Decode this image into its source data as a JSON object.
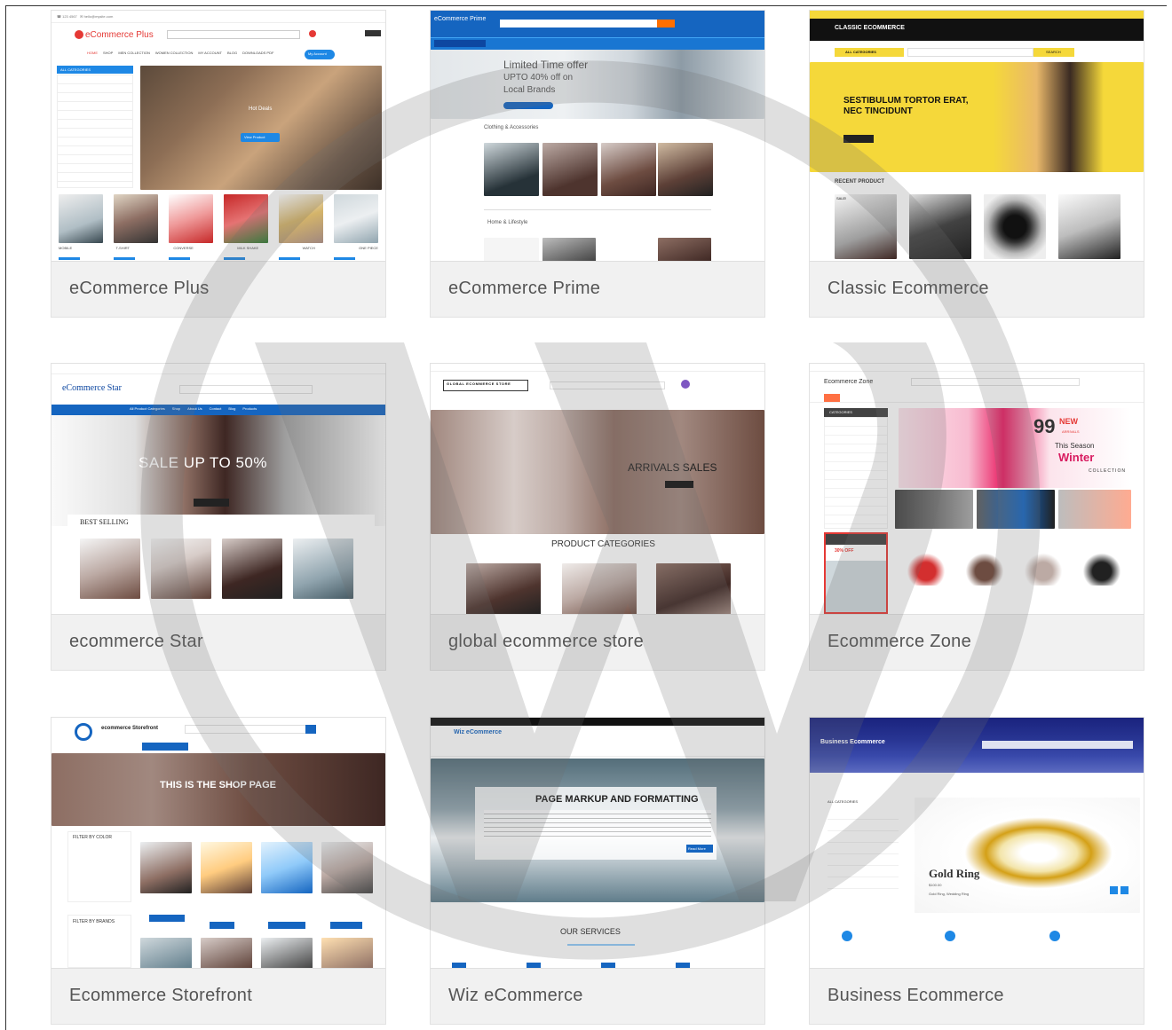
{
  "cards": [
    {
      "title": "eCommerce Plus",
      "hero_text": "Hot Deals",
      "cta": "View Product",
      "brand": "eCommerce Plus",
      "account": "My Account",
      "sidebar_title": "ALL CATEGORIES",
      "nav": [
        "HOME",
        "SHOP",
        "MEN COLLECTION",
        "WOMEN COLLECTION",
        "MY ACCOUNT",
        "BLOG",
        "DOWNLOADS PDF"
      ],
      "products": [
        "MOBILE",
        "T-SHIRT",
        "CONVERSE",
        "MILK SHAKE",
        "WATCH",
        "ONE PIECE"
      ]
    },
    {
      "title": "eCommerce Prime",
      "brand": "eCommerce Prime",
      "hero_line1": "Limited Time offer",
      "hero_line2": "UPTO 40% off on",
      "hero_line3": "Local Brands",
      "section1": "Clothing & Accessories",
      "section2": "Home & Lifestyle"
    },
    {
      "title": "Classic Ecommerce",
      "brand": "CLASSIC ECOMMERCE",
      "all_categories": "ALL CATEGORIES",
      "search": "SEARCH",
      "hero_line1": "SESTIBULUM TORTOR ERAT,",
      "hero_line2": "NEC TINCIDUNT",
      "recent": "RECENT PRODUCT",
      "sale": "SALE!"
    },
    {
      "title": "ecommerce Star",
      "brand": "eCommerce Star",
      "hero": "SALE UP TO 50%",
      "best": "BEST SELLING",
      "nav": [
        "All Product Categories",
        "Shop",
        "About Us",
        "Contact",
        "Blog",
        "Products"
      ]
    },
    {
      "title": "global ecommerce store",
      "brand": "GLOBAL ECOMMERCE STORE",
      "hero": "ARRIVALS SALES",
      "categories": "PRODUCT CATEGORIES"
    },
    {
      "title": "Ecommerce Zone",
      "brand": "Ecommerce Zone",
      "hero_num": "99",
      "hero_new": "NEW",
      "hero_arrivals": "ARRIVALS",
      "hero_season": "This Season",
      "hero_winter": "Winter",
      "hero_collection": "COLLECTION",
      "categories": "CATEGORIES",
      "discount": "30% OFF"
    },
    {
      "title": "Ecommerce Storefront",
      "brand": "ecommerce Storefront",
      "hero": "THIS IS THE SHOP PAGE",
      "filter1": "FILTER BY COLOR",
      "filter2": "FILTER BY BRANDS"
    },
    {
      "title": "Wiz eCommerce",
      "brand": "Wiz eCommerce",
      "hero": "PAGE MARKUP AND FORMATTING",
      "services": "OUR SERVICES",
      "read_more": "Read More"
    },
    {
      "title": "Business Ecommerce",
      "brand": "Business Ecommerce",
      "product": "Gold Ring",
      "price": "$100.00",
      "sub": "Gold Ring, Wedding Ring",
      "all_categories": "ALL CATEGORIES"
    }
  ],
  "colors": {
    "card_bg": "#f1f1f1",
    "title": "#555555",
    "blue": "#1565c0",
    "yellow": "#f5d83a",
    "red": "#e53935"
  }
}
